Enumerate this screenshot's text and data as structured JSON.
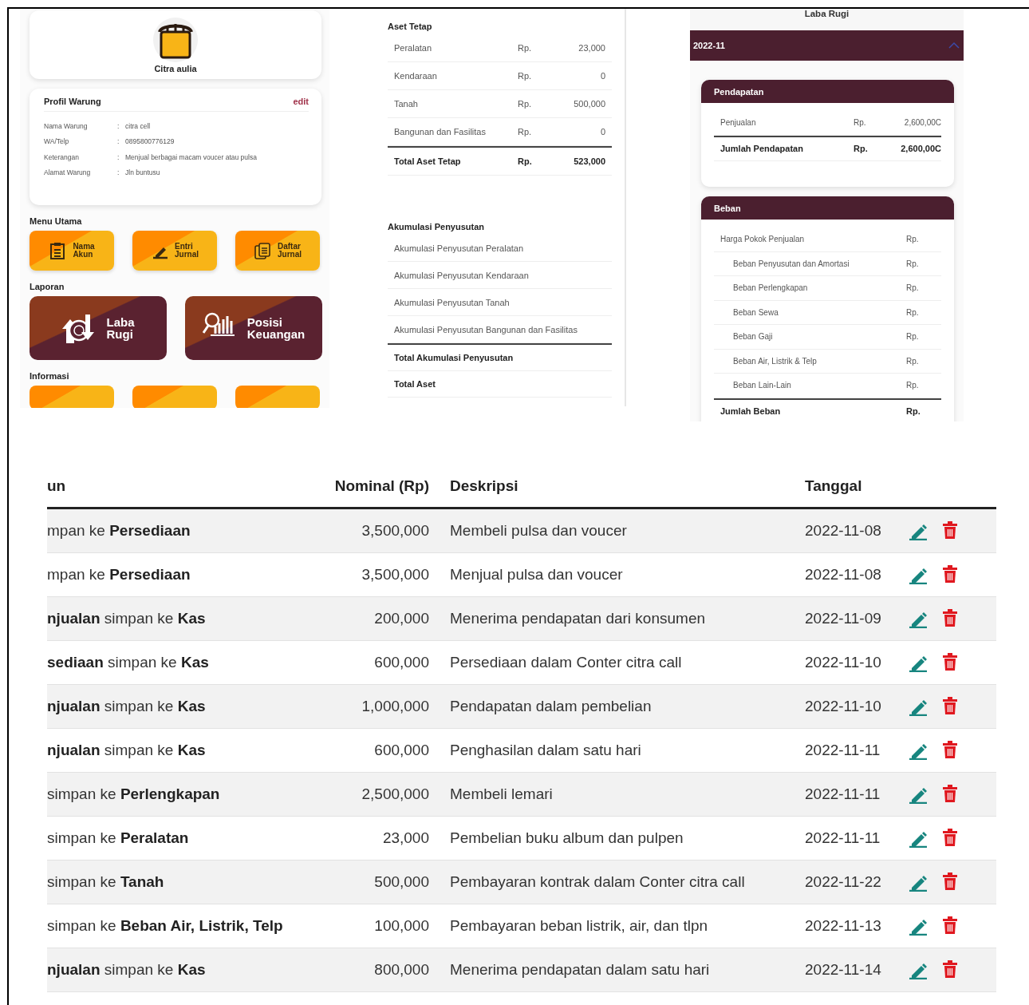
{
  "profile_screen": {
    "store_name": "Citra aulia",
    "profile": {
      "title": "Profil Warung",
      "edit_label": "edit",
      "fields": [
        {
          "label": "Nama Warung",
          "separator": ":",
          "value": "citra cell"
        },
        {
          "label": "WA/Telp",
          "separator": ":",
          "value": "0895800776129"
        },
        {
          "label": "Keterangan",
          "separator": ":",
          "value": "Menjual berbagai macam voucer atau pulsa"
        },
        {
          "label": "Alamat Warung",
          "separator": ":",
          "value": "Jln buntusu"
        }
      ]
    },
    "menu_title": "Menu Utama",
    "menu": [
      {
        "label": "Nama Akun",
        "kind": "list"
      },
      {
        "label": "Entri Jurnal",
        "kind": "pen"
      },
      {
        "label": "Daftar Jurnal",
        "kind": "copy"
      }
    ],
    "reports_title": "Laporan",
    "reports": [
      {
        "label": "Laba Rugi",
        "kind": "profit"
      },
      {
        "label": "Posisi Keuangan",
        "kind": "finance"
      }
    ],
    "info_title": "Informasi"
  },
  "balance_screen": {
    "fixed_assets": {
      "title": "Aset Tetap",
      "rows": [
        {
          "label": "Peralatan",
          "currency": "Rp.",
          "amount": "23,000"
        },
        {
          "label": "Kendaraan",
          "currency": "Rp.",
          "amount": "0"
        },
        {
          "label": "Tanah",
          "currency": "Rp.",
          "amount": "500,000"
        },
        {
          "label": "Bangunan dan Fasilitas",
          "currency": "Rp.",
          "amount": "0"
        }
      ],
      "total": {
        "label": "Total Aset Tetap",
        "currency": "Rp.",
        "amount": "523,000"
      }
    },
    "depreciation": {
      "title": "Akumulasi Penyusutan",
      "rows": [
        {
          "label": "Akumulasi Penyusutan Peralatan"
        },
        {
          "label": "Akumulasi Penyusutan Kendaraan"
        },
        {
          "label": "Akumulasi Penyusutan Tanah"
        },
        {
          "label": "Akumulasi Penyusutan Bangunan dan Fasilitas"
        }
      ],
      "total": {
        "label": "Total Akumulasi Penyusutan"
      }
    },
    "total_assets": {
      "label": "Total Aset"
    }
  },
  "income_screen": {
    "title": "Laba Rugi",
    "period": "2022-11",
    "expanded": true,
    "cards": [
      {
        "title": "Pendapatan",
        "rows": [
          {
            "label": "Penjualan",
            "currency": "Rp.",
            "amount": "2,600,00C"
          }
        ],
        "total": {
          "label": "Jumlah Pendapatan",
          "currency": "Rp.",
          "amount": "2,600,00C"
        }
      },
      {
        "title": "Beban",
        "rows": [
          {
            "label": "Harga Pokok Penjualan",
            "currency": "Rp.",
            "children": [
              {
                "label": "Beban Penyusutan dan Amortasi",
                "currency": "Rp."
              },
              {
                "label": "Beban Perlengkapan",
                "currency": "Rp."
              },
              {
                "label": "Beban Sewa",
                "currency": "Rp."
              },
              {
                "label": "Beban Gaji",
                "currency": "Rp."
              },
              {
                "label": "Beban Air, Listrik & Telp",
                "currency": "Rp."
              },
              {
                "label": "Beban Lain-Lain",
                "currency": "Rp."
              }
            ]
          }
        ],
        "total": {
          "label": "Jumlah Beban",
          "currency": "Rp."
        }
      }
    ]
  },
  "journal_table": {
    "columns": [
      "un",
      "Nominal (Rp)",
      "Deskripsi",
      "Tanggal"
    ],
    "rows": [
      {
        "account": "mpan ke **Persediaan**",
        "nominal": "3,500,000",
        "description": "Membeli pulsa dan voucer",
        "date": "2022-11-08"
      },
      {
        "account": "mpan ke **Persediaan**",
        "nominal": "3,500,000",
        "description": "Menjual pulsa dan voucer",
        "date": "2022-11-08"
      },
      {
        "account": "**njualan** simpan ke **Kas**",
        "nominal": "200,000",
        "description": "Menerima pendapatan dari konsumen",
        "date": "2022-11-09"
      },
      {
        "account": "**sediaan** simpan ke **Kas**",
        "nominal": "600,000",
        "description": "Persediaan dalam Conter citra call",
        "date": "2022-11-10"
      },
      {
        "account": "**njualan** simpan ke **Kas**",
        "nominal": "1,000,000",
        "description": "Pendapatan dalam pembelian",
        "date": "2022-11-10"
      },
      {
        "account": "**njualan** simpan ke **Kas**",
        "nominal": "600,000",
        "description": "Penghasilan dalam satu hari",
        "date": "2022-11-11"
      },
      {
        "account": "simpan ke **Perlengkapan**",
        "nominal": "2,500,000",
        "description": "Membeli lemari",
        "date": "2022-11-11"
      },
      {
        "account": "simpan ke **Peralatan**",
        "nominal": "23,000",
        "description": "Pembelian buku album dan pulpen",
        "date": "2022-11-11"
      },
      {
        "account": "simpan ke **Tanah**",
        "nominal": "500,000",
        "description": "Pembayaran kontrak dalam Conter citra call",
        "date": "2022-11-22"
      },
      {
        "account": "simpan ke **Beban Air, Listrik, Telp**",
        "nominal": "100,000",
        "description": "Pembayaran beban listrik, air, dan tlpn",
        "date": "2022-11-13"
      },
      {
        "account": "**njualan** simpan ke **Kas**",
        "nominal": "800,000",
        "description": "Menerima pendapatan dalam satu hari",
        "date": "2022-11-14"
      }
    ]
  }
}
